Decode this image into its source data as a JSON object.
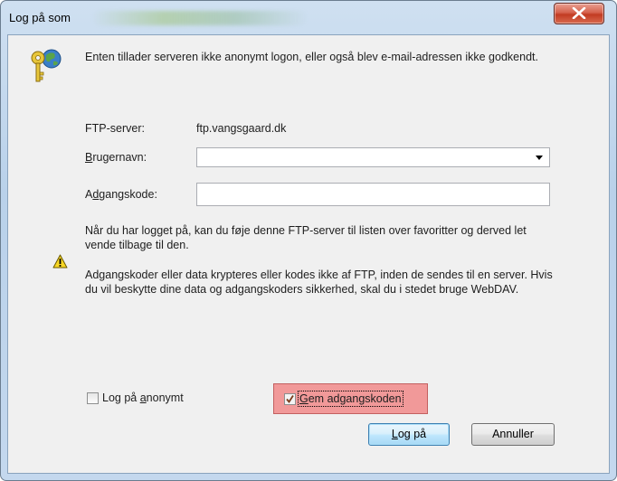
{
  "window": {
    "title": "Log på som"
  },
  "message": "Enten tillader serveren ikke anonymt logon, eller også blev e-mail-adressen ikke godkendt.",
  "ftp_server": {
    "label": "FTP-server:",
    "value": "ftp.vangsgaard.dk"
  },
  "username": {
    "label_pre": "",
    "label_key": "B",
    "label_post": "rugernavn:",
    "value": ""
  },
  "password": {
    "label_pre": "A",
    "label_key": "d",
    "label_post": "gangskode:",
    "value": ""
  },
  "info_text": "Når du har logget på, kan du føje denne FTP-server til listen over favoritter og derved let vende tilbage til den.",
  "warning_text": "Adgangskoder eller data krypteres eller kodes ikke af FTP, inden de sendes til en server. Hvis du vil beskytte dine data og adgangskoders sikkerhed, skal du i stedet bruge WebDAV.",
  "anonymous_checkbox": {
    "label_pre": "Log på ",
    "label_key": "a",
    "label_post": "nonymt",
    "checked": false
  },
  "save_password_checkbox": {
    "label_pre": "",
    "label_key": "G",
    "label_post": "em adgangskoden",
    "checked": true
  },
  "buttons": {
    "login_key": "L",
    "login_rest": "og på",
    "cancel": "Annuller"
  },
  "icons": {
    "dialog": "keys-globe-icon",
    "warning": "warning-icon",
    "close": "close-icon",
    "dropdown": "chevron-down-icon"
  },
  "colors": {
    "highlight": "#f19999",
    "close_button": "#c9452d"
  }
}
